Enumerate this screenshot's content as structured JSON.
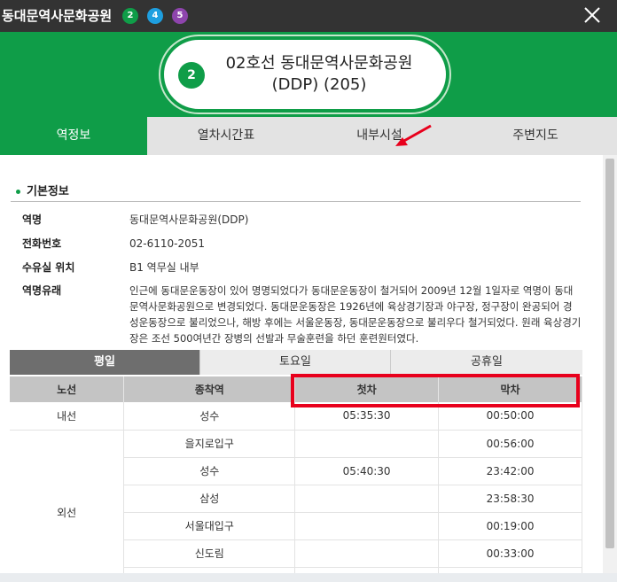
{
  "window": {
    "title": "동대문역사문화공원",
    "lines": [
      {
        "label": "2",
        "color": "#0f9d48"
      },
      {
        "label": "4",
        "color": "#1e9fe0"
      },
      {
        "label": "5",
        "color": "#8e44ad"
      }
    ]
  },
  "station": {
    "badge": "2",
    "title_line1": "02호선 동대문역사문화공원",
    "title_line2": "(DDP) (205)"
  },
  "tabs": [
    "역정보",
    "열차시간표",
    "내부시설",
    "주변지도"
  ],
  "info": {
    "section_title": "기본정보",
    "rows": [
      {
        "key": "역명",
        "value": "동대문역사문화공원(DDP)"
      },
      {
        "key": "전화번호",
        "value": "02-6110-2051"
      },
      {
        "key": "수유실 위치",
        "value": "B1 역무실 내부"
      },
      {
        "key": "역명유래",
        "value": "인근에 동대문운동장이 있어 명명되었다가 동대문운동장이 철거되어 2009년 12월 1일자로 역명이 동대문역사문화공원으로 변경되었다. 동대문운동장은 1926년에 육상경기장과 야구장, 정구장이 완공되어 경성운동장으로 불리었으나, 해방 후에는 서울운동장, 동대문운동장으로 불리우다 철거되었다. 원래 육상경기장은 조선 500여년간 장병의 선발과 무술훈련을 하던 훈련원터였다."
      }
    ]
  },
  "schedule": {
    "day_tabs": [
      "평일",
      "토요일",
      "공휴일"
    ],
    "columns": [
      "노선",
      "종착역",
      "첫차",
      "막차"
    ],
    "groups": [
      {
        "line": "내선",
        "rows": [
          {
            "dest": "성수",
            "first": "05:35:30",
            "last": "00:50:00"
          }
        ]
      },
      {
        "line": "외선",
        "rows": [
          {
            "dest": "을지로입구",
            "first": "",
            "last": "00:56:00"
          },
          {
            "dest": "성수",
            "first": "05:40:30",
            "last": "23:42:00"
          },
          {
            "dest": "삼성",
            "first": "",
            "last": "23:58:30"
          },
          {
            "dest": "서울대입구",
            "first": "",
            "last": "00:19:00"
          },
          {
            "dest": "신도림",
            "first": "",
            "last": "00:33:00"
          }
        ]
      }
    ]
  },
  "colors": {
    "accent": "#0f9d48",
    "highlight": "#e8001c"
  }
}
